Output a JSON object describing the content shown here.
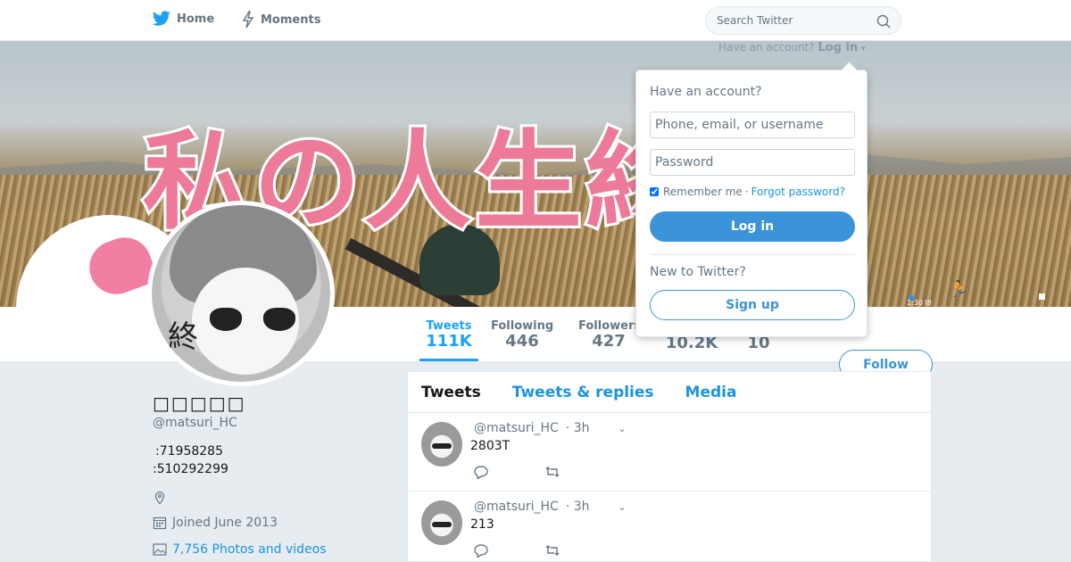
{
  "nav": {
    "home_label": "Home",
    "moments_label": "Moments",
    "search_placeholder": "Search Twitter"
  },
  "banner": {
    "title_text": "私の人生終",
    "exclaim": "!",
    "hud_time": "1:30 l8"
  },
  "login_hint": {
    "question": "Have an account?",
    "login_label": "Log in"
  },
  "profile": {
    "name": "□□□□□",
    "handle": "@matsuri_HC",
    "bio_lines": [
      ":71958285",
      ":510292299"
    ],
    "joined": "Joined June 2013",
    "photos_videos": "7,756 Photos and videos",
    "avatar_kanji": "終"
  },
  "stats": [
    {
      "label": "Tweets",
      "value": "111K",
      "active": true
    },
    {
      "label": "Following",
      "value": "446",
      "active": false
    },
    {
      "label": "Followers",
      "value": "427",
      "active": false
    },
    {
      "label": "",
      "value": "10.2K",
      "active": false
    },
    {
      "label": "",
      "value": "10",
      "active": false
    }
  ],
  "follow_label": "Follow",
  "tabs": [
    {
      "label": "Tweets",
      "active": true
    },
    {
      "label": "Tweets & replies",
      "active": false
    },
    {
      "label": "Media",
      "active": false
    }
  ],
  "tweets": [
    {
      "handle": "@matsuri_HC",
      "time": "· 3h",
      "text": "2803T"
    },
    {
      "handle": "@matsuri_HC",
      "time": "· 3h",
      "text": "213"
    }
  ],
  "dropdown": {
    "heading": "Have an account?",
    "username_placeholder": "Phone, email, or username",
    "password_placeholder": "Password",
    "remember_label": "Remember me",
    "separator": "·",
    "forgot_label": "Forgot password?",
    "login_button": "Log in",
    "new_heading": "New to Twitter?",
    "signup_button": "Sign up"
  },
  "colors": {
    "accent": "#1da1f2",
    "button": "#3b94d9",
    "banner_text": "#ec7a98"
  }
}
